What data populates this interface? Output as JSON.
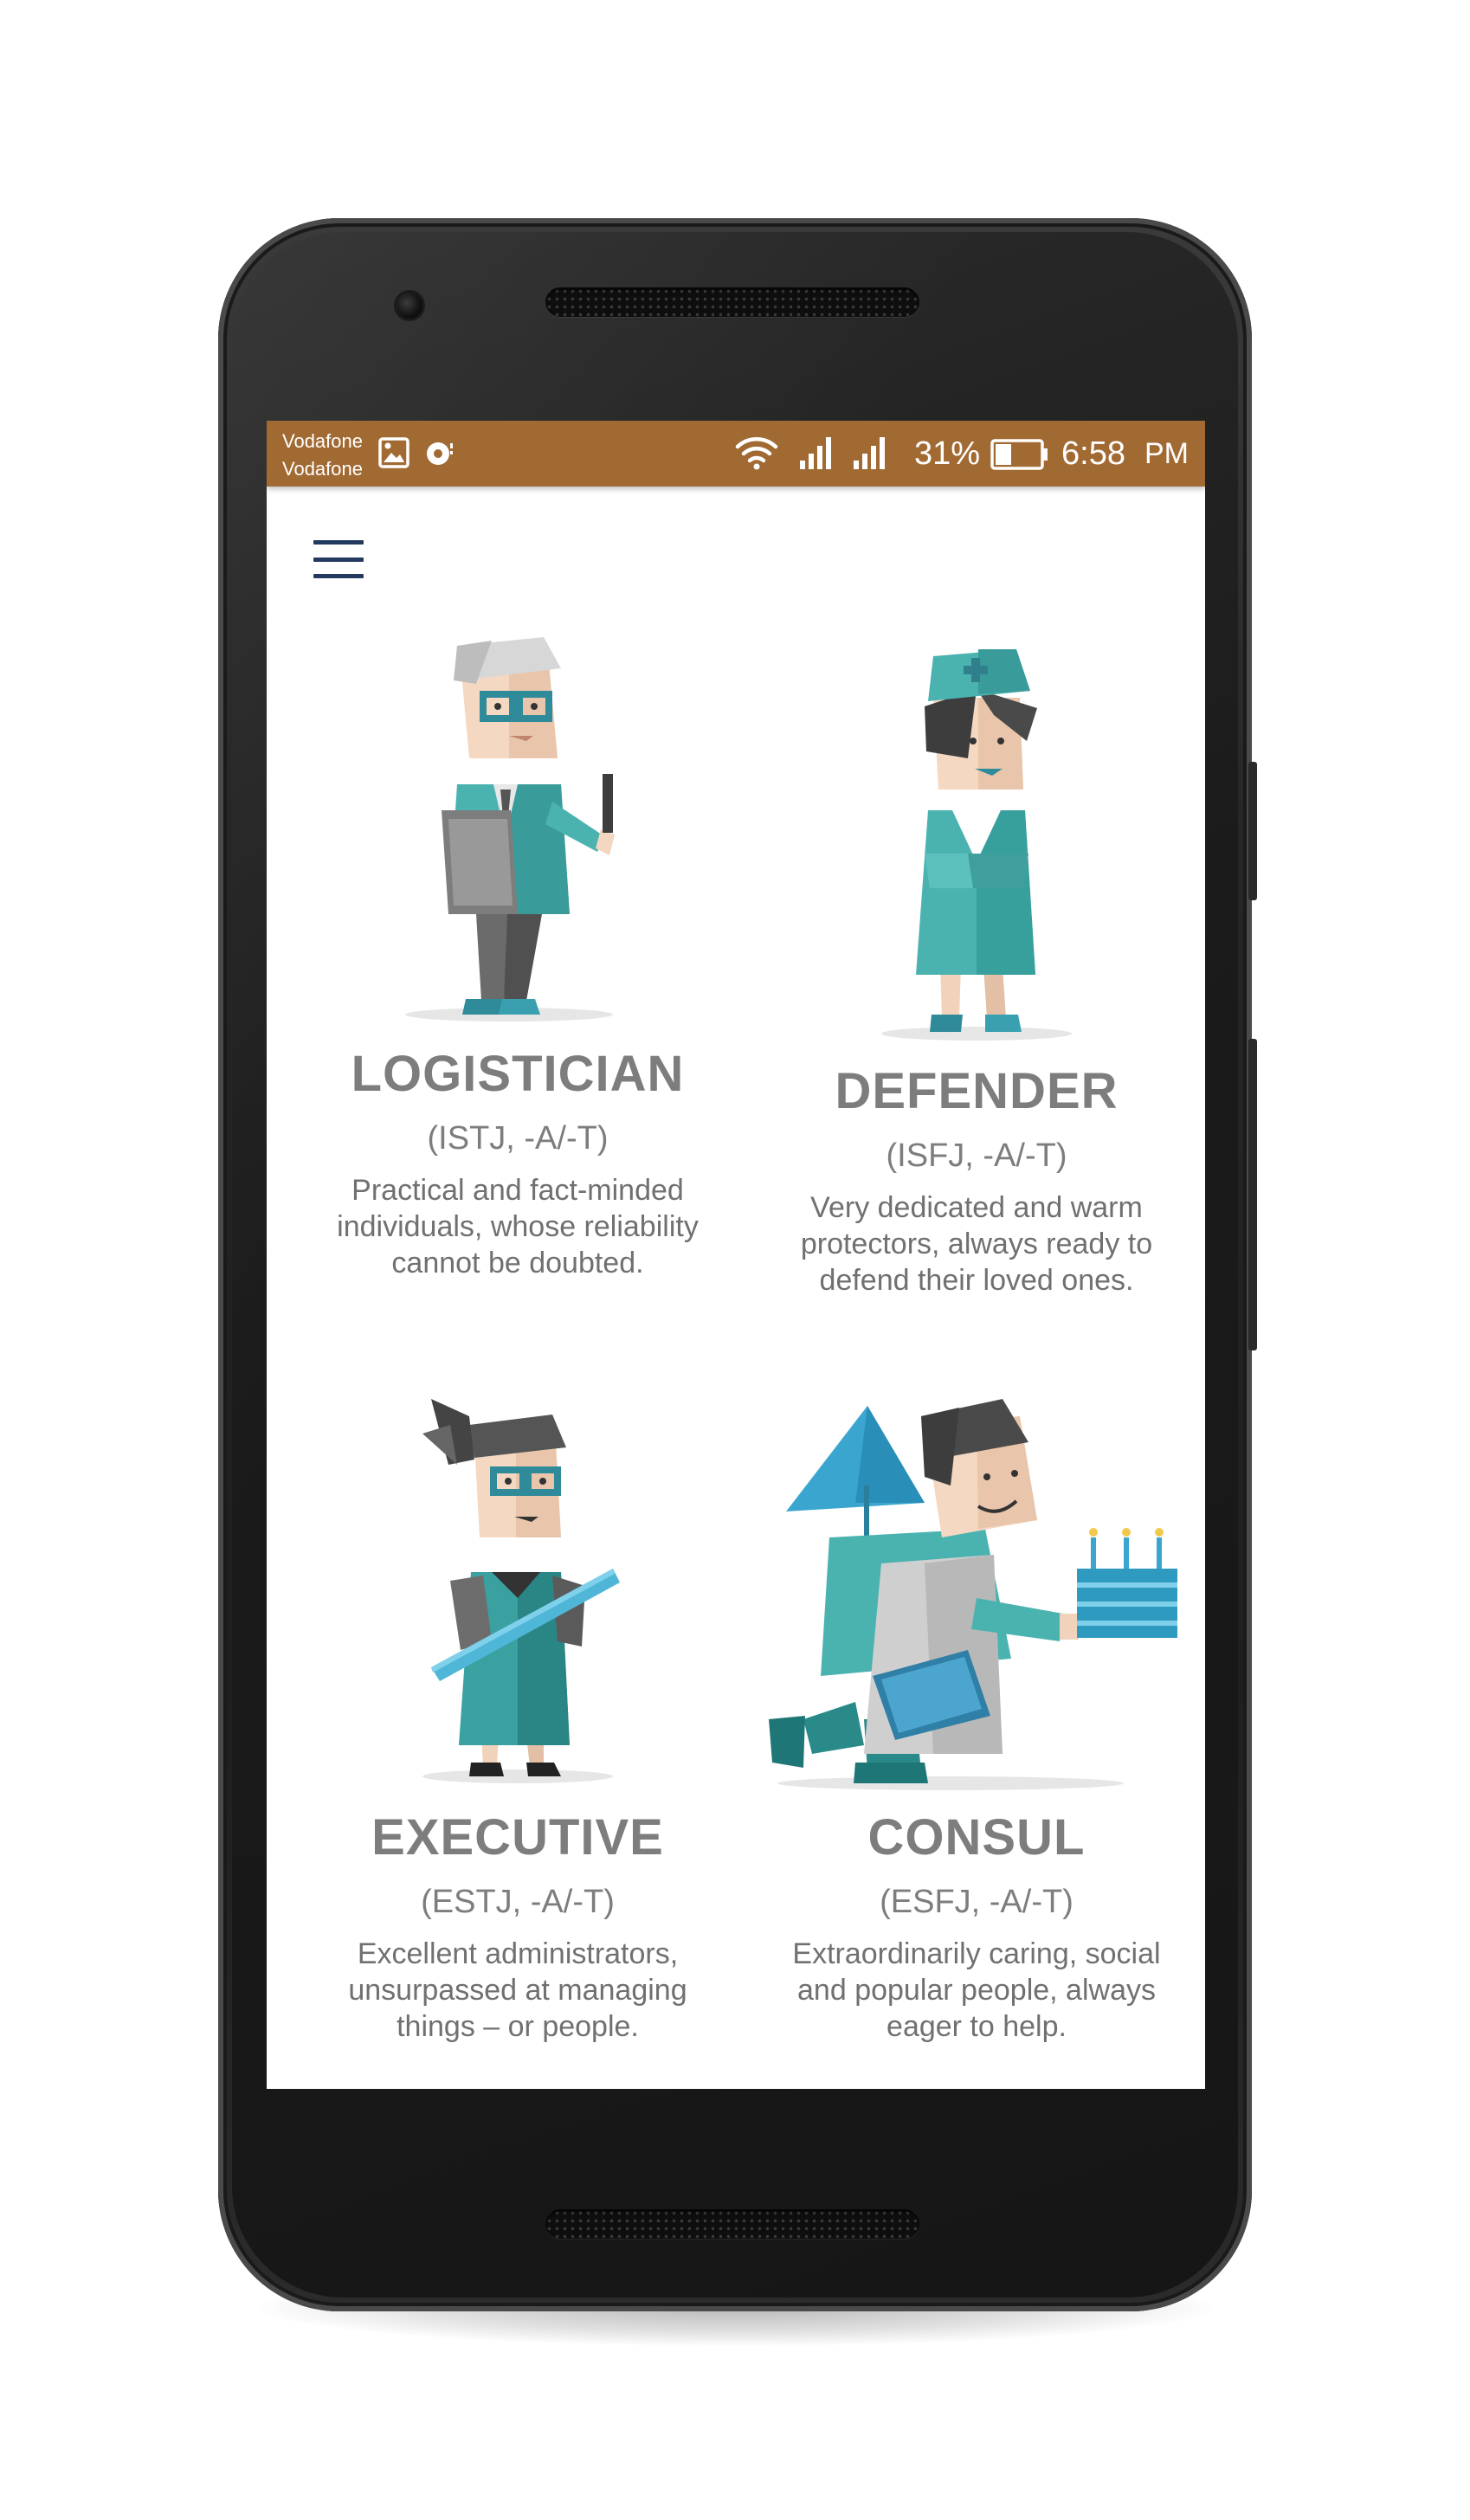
{
  "status_bar": {
    "carrier_1": "Vodafone",
    "carrier_2": "Vodafone",
    "battery_percent": "31%",
    "time": "6:58",
    "ampm": "PM",
    "background_color": "#a26a33"
  },
  "menu": {
    "icon": "hamburger-menu-icon"
  },
  "personalities": [
    {
      "name": "LOGISTICIAN",
      "code": "(ISTJ, -A/-T)",
      "description": "Practical and fact-minded individuals, whose reliability cannot be doubted.",
      "illustration": "logistician-figure"
    },
    {
      "name": "DEFENDER",
      "code": "(ISFJ, -A/-T)",
      "description": "Very dedicated and warm protectors, always ready to defend their loved ones.",
      "illustration": "defender-figure"
    },
    {
      "name": "EXECUTIVE",
      "code": "(ESTJ, -A/-T)",
      "description": "Excellent administrators, unsurpassed at managing things – or people.",
      "illustration": "executive-figure"
    },
    {
      "name": "CONSUL",
      "code": "(ESFJ, -A/-T)",
      "description": "Extraordinarily caring, social and popular people, always eager to help.",
      "illustration": "consul-figure"
    }
  ],
  "colors": {
    "teal": "#4aa8a8",
    "title_gray": "#7d7d7d",
    "menu_navy": "#233a5e"
  }
}
